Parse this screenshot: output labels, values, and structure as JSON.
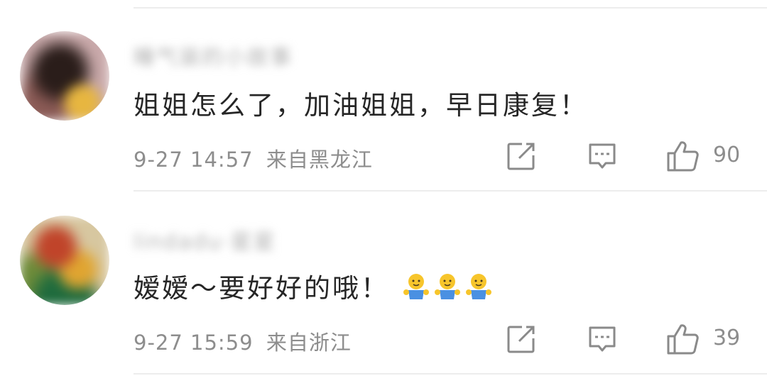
{
  "comments": [
    {
      "username": "睡气装的小故事",
      "text": "姐姐怎么了，加油姐姐，早日康复！",
      "emoji_icons": [],
      "time": "9-27 14:57",
      "location": "来自黑龙江",
      "likes": "90"
    },
    {
      "username": "lindadu·星星",
      "text": "嫒嫒～要好好的哦！",
      "emoji_icons": [
        "hug-emoji-icon",
        "hug-emoji-icon",
        "hug-emoji-icon"
      ],
      "time": "9-27 15:59",
      "location": "来自浙江",
      "likes": "39"
    }
  ],
  "colors": {
    "text": "#262626",
    "meta": "#8d8d8d",
    "icon": "#8a8a8a",
    "divider": "#ededed",
    "emoji_face": "#f7c52b",
    "emoji_shirt": "#4a90e2"
  }
}
